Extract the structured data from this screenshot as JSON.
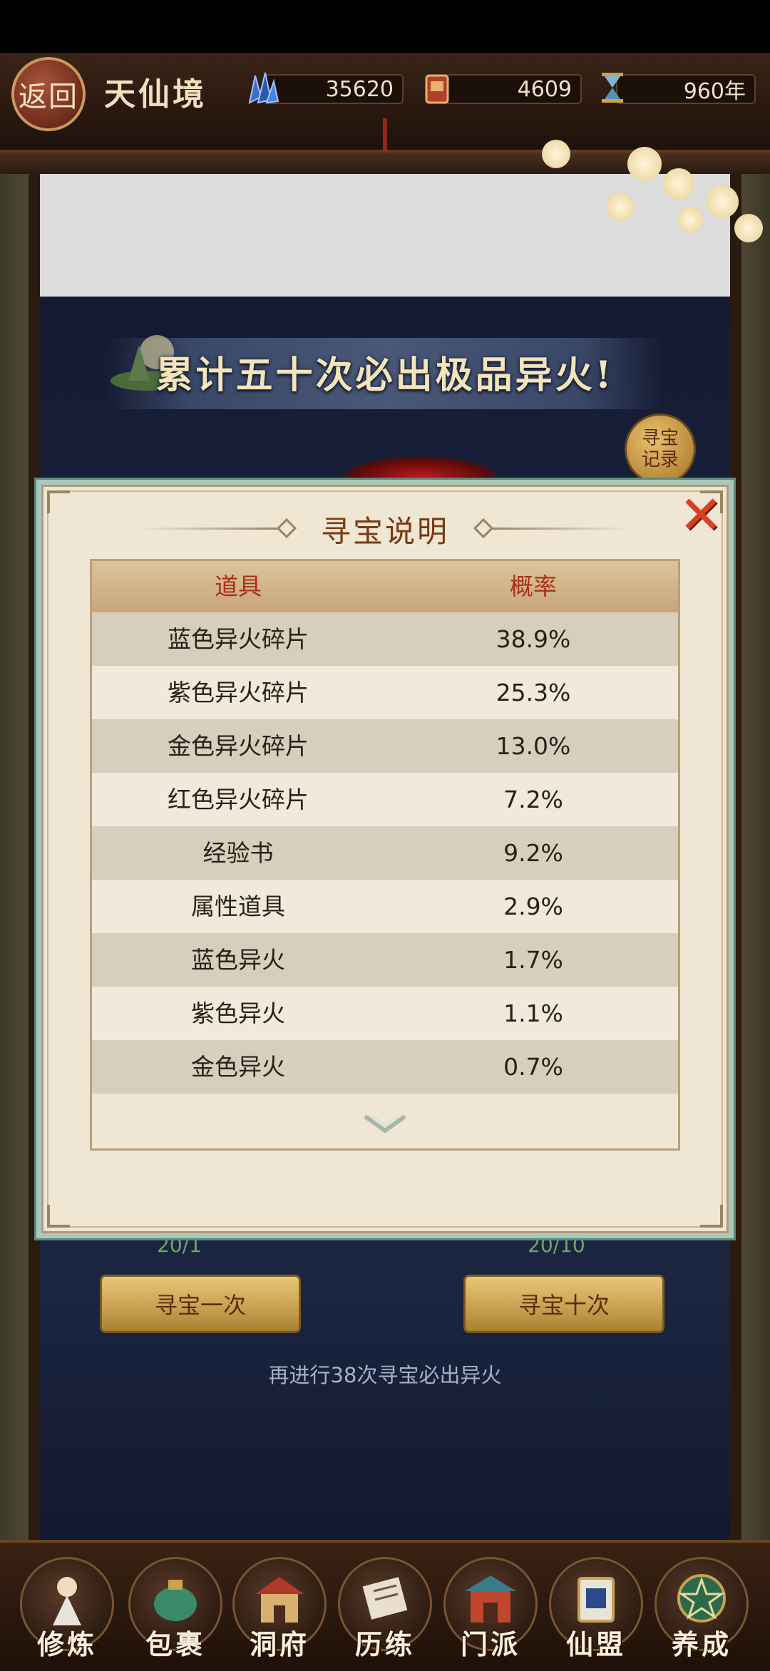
{
  "header": {
    "back_label": "返回",
    "realm": "天仙境",
    "resources": [
      {
        "icon": "crystal-icon",
        "value": "35620"
      },
      {
        "icon": "pouch-icon",
        "value": "4609"
      },
      {
        "icon": "hourglass-icon",
        "value": "960年"
      }
    ]
  },
  "main": {
    "banner": "累计五十次必出极品异火!",
    "record_button": "寻宝\n记录",
    "counts": {
      "left": "20/1",
      "right": "20/10"
    },
    "buttons": {
      "once": "寻宝一次",
      "ten": "寻宝十次"
    },
    "hint": "再进行38次寻宝必出异火"
  },
  "dialog": {
    "title": "寻宝说明",
    "close_icon": "close-icon",
    "columns": [
      "道具",
      "概率"
    ],
    "rows": [
      {
        "item": "蓝色异火碎片",
        "rate": "38.9%"
      },
      {
        "item": "紫色异火碎片",
        "rate": "25.3%"
      },
      {
        "item": "金色异火碎片",
        "rate": "13.0%"
      },
      {
        "item": "红色异火碎片",
        "rate": "7.2%"
      },
      {
        "item": "经验书",
        "rate": "9.2%"
      },
      {
        "item": "属性道具",
        "rate": "2.9%"
      },
      {
        "item": "蓝色异火",
        "rate": "1.7%"
      },
      {
        "item": "紫色异火",
        "rate": "1.1%"
      },
      {
        "item": "金色异火",
        "rate": "0.7%"
      }
    ]
  },
  "nav": [
    {
      "label": "修炼",
      "icon": "cultivation-icon"
    },
    {
      "label": "包裹",
      "icon": "bag-icon"
    },
    {
      "label": "洞府",
      "icon": "cave-icon"
    },
    {
      "label": "历练",
      "icon": "scroll-icon"
    },
    {
      "label": "门派",
      "icon": "sect-icon"
    },
    {
      "label": "仙盟",
      "icon": "alliance-icon"
    },
    {
      "label": "养成",
      "icon": "growth-icon"
    }
  ],
  "colors": {
    "accent_gold": "#c9a252",
    "title_brown": "#7a3a12",
    "header_red": "#a8301a",
    "close_red": "#d8401e"
  }
}
